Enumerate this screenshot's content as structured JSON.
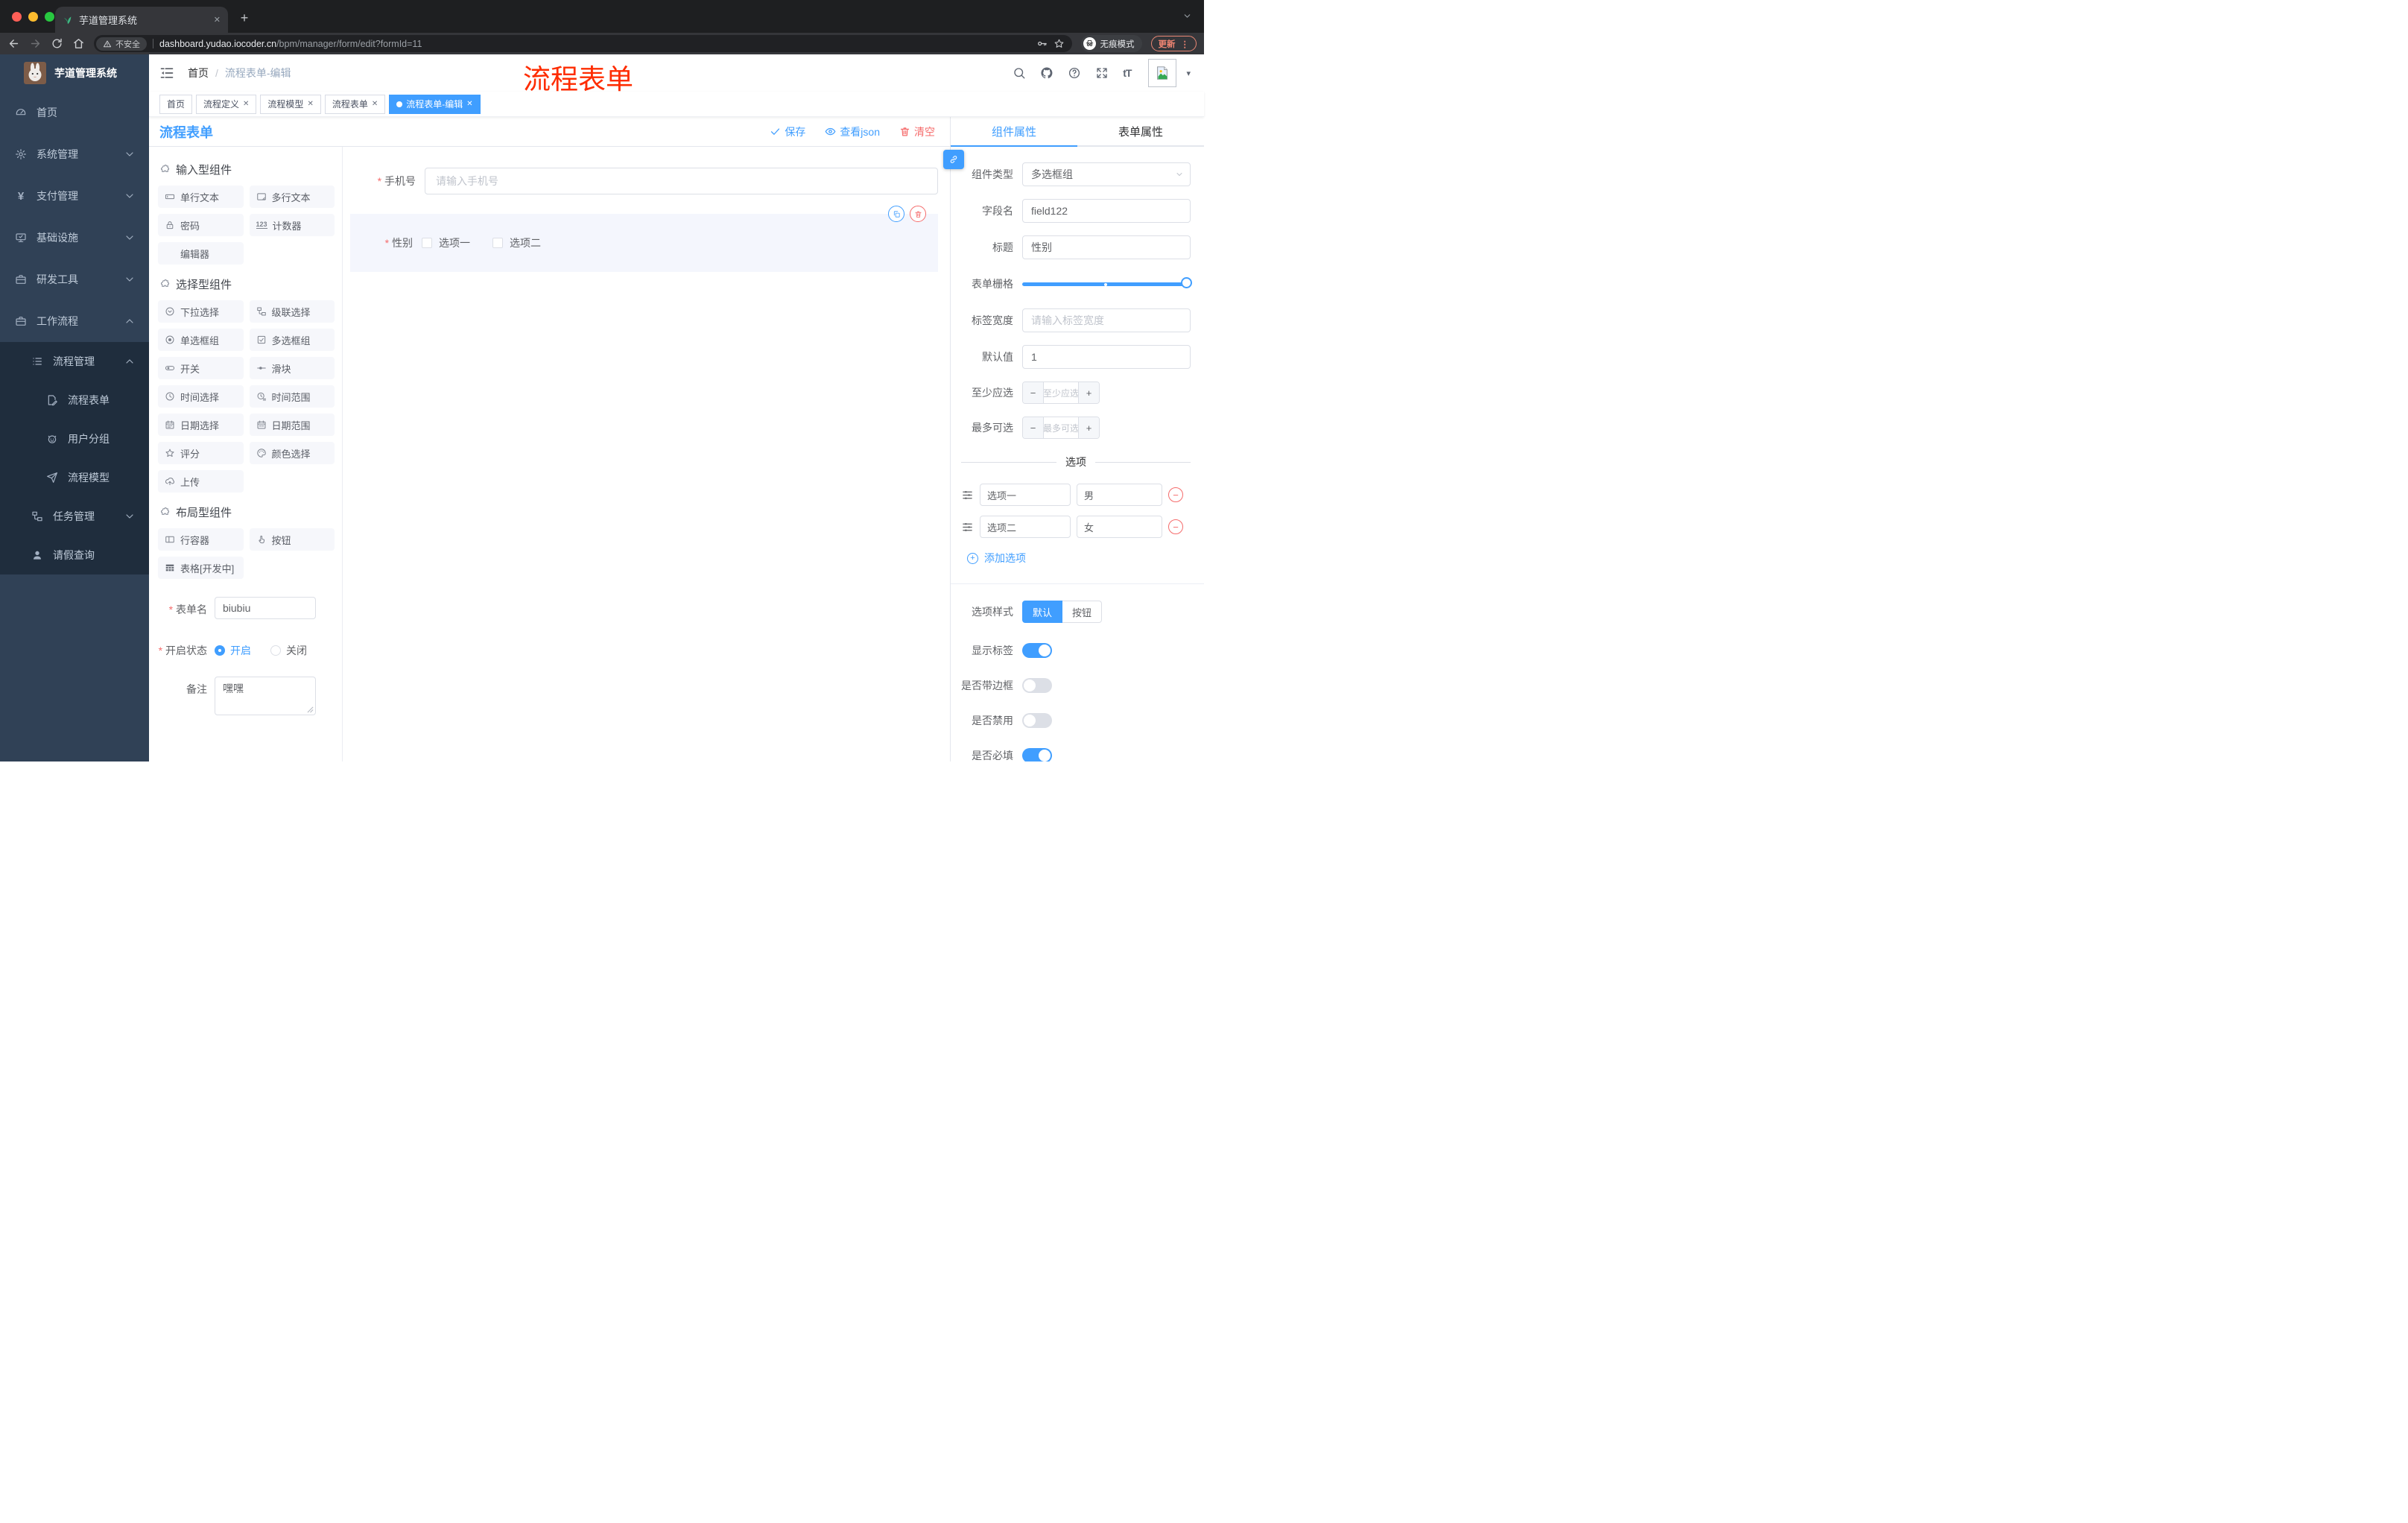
{
  "browser": {
    "tab_title": "芋道管理系统",
    "security_label": "不安全",
    "url_host": "dashboard.yudao.iocoder.cn",
    "url_path": "/bpm/manager/form/edit?formId=11",
    "incognito_label": "无痕模式",
    "update_label": "更新"
  },
  "icons": {
    "close": "✕",
    "plus": "+",
    "minus": "−",
    "dots_vertical": "⋮",
    "caret_down": "▾",
    "fontsize": "tT",
    "counter": "123",
    "yen": "¥"
  },
  "sidebar": {
    "brand": "芋道管理系统",
    "menu": [
      {
        "label": "首页"
      },
      {
        "label": "系统管理"
      },
      {
        "label": "支付管理"
      },
      {
        "label": "基础设施"
      },
      {
        "label": "研发工具"
      },
      {
        "label": "工作流程"
      },
      {
        "label": "流程管理"
      },
      {
        "label": "流程表单"
      },
      {
        "label": "用户分组"
      },
      {
        "label": "流程模型"
      },
      {
        "label": "任务管理"
      },
      {
        "label": "请假查询"
      }
    ]
  },
  "navbar": {
    "breadcrumb_home": "首页",
    "breadcrumb_sep": "/",
    "breadcrumb_current": "流程表单-编辑"
  },
  "annotation": {
    "text": "流程表单",
    "color": "#fe2c00"
  },
  "tags": [
    "首页",
    "流程定义",
    "流程模型",
    "流程表单",
    "流程表单-编辑"
  ],
  "designer": {
    "title": "流程表单",
    "save": "保存",
    "view_json": "查看json",
    "clear": "清空"
  },
  "palette": {
    "input_section": "输入型组件",
    "input_items": [
      "单行文本",
      "多行文本",
      "密码",
      "计数器",
      "编辑器"
    ],
    "select_section": "选择型组件",
    "select_items": [
      "下拉选择",
      "级联选择",
      "单选框组",
      "多选框组",
      "开关",
      "滑块",
      "时间选择",
      "时间范围",
      "日期选择",
      "日期范围",
      "评分",
      "颜色选择",
      "上传"
    ],
    "layout_section": "布局型组件",
    "layout_items": [
      "行容器",
      "按钮",
      "表格[开发中]"
    ]
  },
  "left_form": {
    "name_label": "表单名",
    "name_value": "biubiu",
    "status_label": "开启状态",
    "status_on": "开启",
    "status_off": "关闭",
    "remark_label": "备注",
    "remark_value": "嘿嘿"
  },
  "canvas": {
    "phone_label": "手机号",
    "phone_placeholder": "请输入手机号",
    "gender_label": "性别",
    "gender_opt1": "选项一",
    "gender_opt2": "选项二"
  },
  "panel": {
    "tab_component": "组件属性",
    "tab_form": "表单属性",
    "type_label": "组件类型",
    "type_value": "多选框组",
    "field_label": "字段名",
    "field_value": "field122",
    "title_label": "标题",
    "title_value": "性别",
    "grid_label": "表单栅格",
    "width_label": "标签宽度",
    "width_placeholder": "请输入标签宽度",
    "default_label": "默认值",
    "default_value": "1",
    "min_label": "至少应选",
    "min_placeholder": "至少应选",
    "max_label": "最多可选",
    "max_placeholder": "最多可选",
    "options_title": "选项",
    "opt1_label": "选项一",
    "opt1_value": "男",
    "opt2_label": "选项二",
    "opt2_value": "女",
    "add_option": "添加选项",
    "style_label": "选项样式",
    "style_default": "默认",
    "style_button": "按钮",
    "show_label": "显示标签",
    "border_label": "是否带边框",
    "disabled_label": "是否禁用",
    "required_label": "是否必填"
  },
  "colors": {
    "accent": "#409eff",
    "danger": "#f56c6c"
  }
}
